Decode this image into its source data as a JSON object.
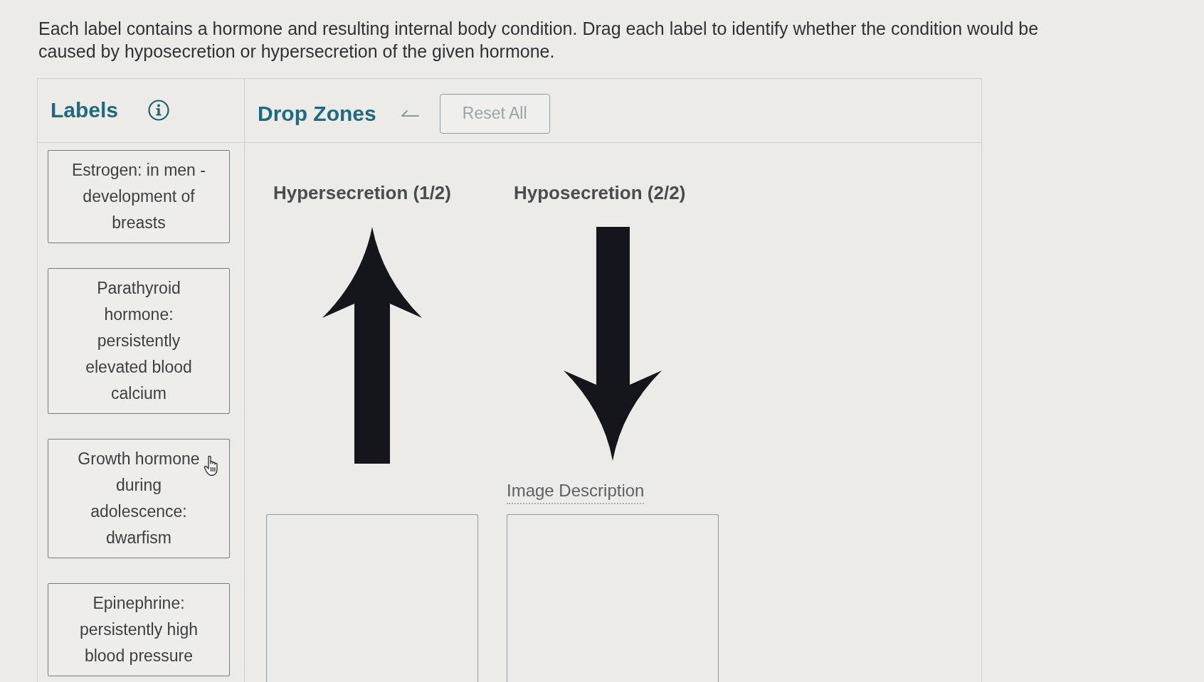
{
  "instructions": "Each label contains a hormone and resulting internal body condition. Drag each label to identify whether the condition would be caused by hyposecretion or hypersecretion of the given hormone.",
  "labels_panel": {
    "title": "Labels",
    "cards": [
      "Estrogen: in men - development of breasts",
      "Parathyroid hormone: persistently elevated blood calcium",
      "Growth hormone during adolescence: dwarfism",
      "Epinephrine: persistently high blood pressure"
    ]
  },
  "drop_panel": {
    "title": "Drop Zones",
    "reset_button": {
      "label": "Reset All",
      "disabled": true
    },
    "zones": [
      {
        "heading": "Hypersecretion (1/2)",
        "kind": "up"
      },
      {
        "heading": "Hyposecretion (2/2)",
        "kind": "down",
        "image_link": "Image Description"
      }
    ]
  }
}
